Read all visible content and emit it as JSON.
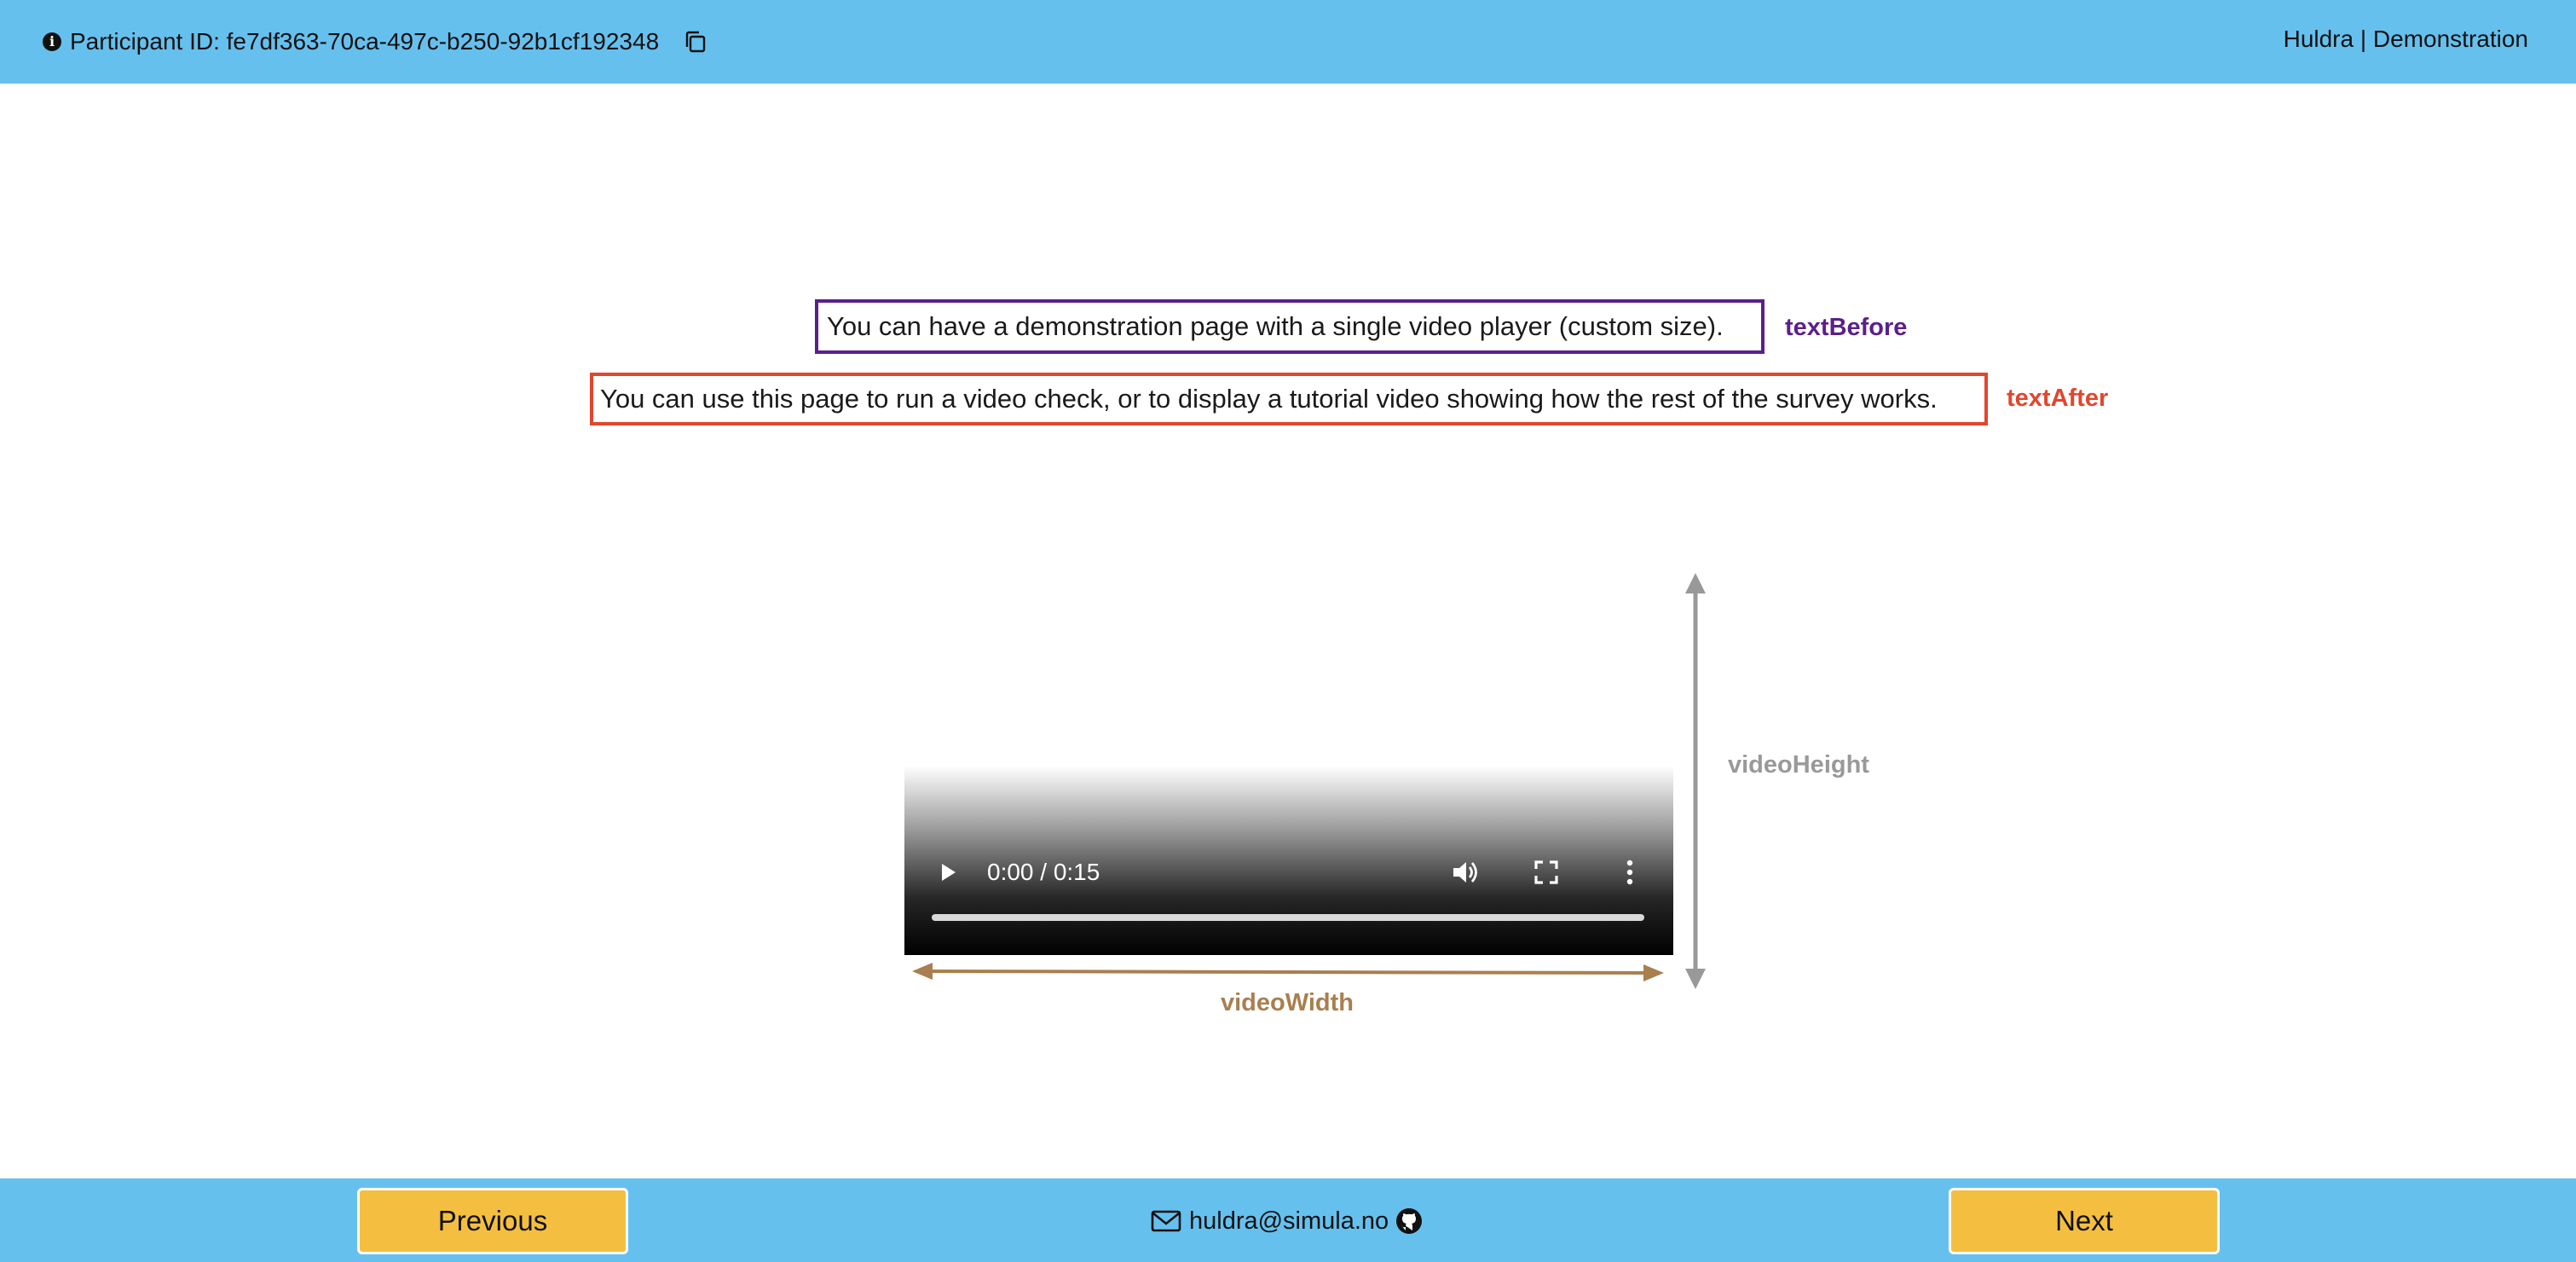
{
  "header": {
    "participant_label": "Participant ID: fe7df363-70ca-497c-b250-92b1cf192348",
    "brand": "Huldra | Demonstration",
    "icons": [
      "info-icon",
      "copy-icon"
    ]
  },
  "content": {
    "text_before": "You can have a demonstration page with a single video player (custom size).",
    "text_before_label": "textBefore",
    "text_after": "You can use this page to run a video check, or to display a tutorial video showing how the rest of the survey works.",
    "text_after_label": "textAfter"
  },
  "video": {
    "time": "0:00 / 0:15",
    "progress": 0,
    "height_label": "videoHeight",
    "width_label": "videoWidth"
  },
  "footer": {
    "previous_label": "Previous",
    "next_label": "Next",
    "email": "huldra@simula.no"
  },
  "colors": {
    "bar": "#66c0ee",
    "button": "#f4bf41",
    "text_before_accent": "#5b1f8a",
    "text_after_accent": "#e2462c",
    "height_annotation": "#999999",
    "width_annotation": "#a97f4f"
  }
}
